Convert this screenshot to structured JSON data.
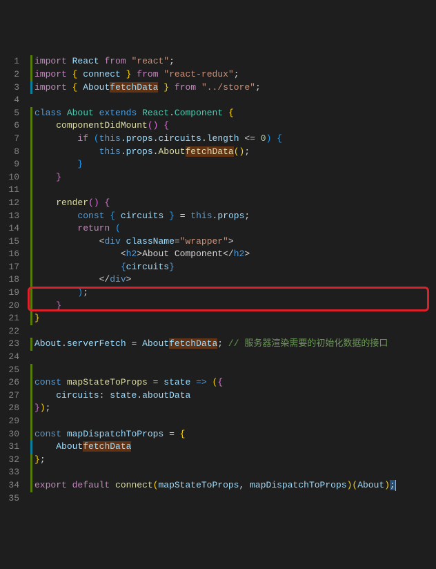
{
  "gutter": {
    "start": 1,
    "end": 35
  },
  "highlight_word": "fetchData",
  "code": {
    "l1": {
      "tokens": [
        [
          "kw2",
          "import"
        ],
        [
          "op",
          " "
        ],
        [
          "var",
          "React"
        ],
        [
          "op",
          " "
        ],
        [
          "kw2",
          "from"
        ],
        [
          "op",
          " "
        ],
        [
          "str",
          "\"react\""
        ],
        [
          "pun",
          ";"
        ]
      ],
      "mod": "green"
    },
    "l2": {
      "tokens": [
        [
          "kw2",
          "import"
        ],
        [
          "op",
          " "
        ],
        [
          "brk",
          "{"
        ],
        [
          "op",
          " "
        ],
        [
          "var",
          "connect"
        ],
        [
          "op",
          " "
        ],
        [
          "brk",
          "}"
        ],
        [
          "op",
          " "
        ],
        [
          "kw2",
          "from"
        ],
        [
          "op",
          " "
        ],
        [
          "str",
          "\"react-redux\""
        ],
        [
          "pun",
          ";"
        ]
      ],
      "mod": "green"
    },
    "l3": {
      "tokens": [
        [
          "kw2",
          "import"
        ],
        [
          "op",
          " "
        ],
        [
          "brk",
          "{"
        ],
        [
          "op",
          " "
        ],
        [
          "var",
          "About"
        ],
        [
          "var hl",
          "fetchData"
        ],
        [
          "op",
          " "
        ],
        [
          "brk",
          "}"
        ],
        [
          "op",
          " "
        ],
        [
          "kw2",
          "from"
        ],
        [
          "op",
          " "
        ],
        [
          "str",
          "\"../store\""
        ],
        [
          "pun",
          ";"
        ]
      ],
      "mod": "blue"
    },
    "l4": {
      "tokens": [],
      "mod": null
    },
    "l5": {
      "tokens": [
        [
          "kw",
          "class"
        ],
        [
          "op",
          " "
        ],
        [
          "cls",
          "About"
        ],
        [
          "op",
          " "
        ],
        [
          "kw",
          "extends"
        ],
        [
          "op",
          " "
        ],
        [
          "cls",
          "React"
        ],
        [
          "pun",
          "."
        ],
        [
          "cls",
          "Component"
        ],
        [
          "op",
          " "
        ],
        [
          "brk",
          "{"
        ]
      ],
      "mod": "green"
    },
    "l6": {
      "tokens": [
        [
          "op",
          "    "
        ],
        [
          "fn",
          "componentDidMount"
        ],
        [
          "brk2",
          "()"
        ],
        [
          "op",
          " "
        ],
        [
          "brk2",
          "{"
        ]
      ],
      "mod": "green"
    },
    "l7": {
      "tokens": [
        [
          "op",
          "        "
        ],
        [
          "kw2",
          "if"
        ],
        [
          "op",
          " "
        ],
        [
          "brk3",
          "("
        ],
        [
          "kw",
          "this"
        ],
        [
          "pun",
          "."
        ],
        [
          "var",
          "props"
        ],
        [
          "pun",
          "."
        ],
        [
          "var",
          "circuits"
        ],
        [
          "pun",
          "."
        ],
        [
          "var",
          "length"
        ],
        [
          "op",
          " <= "
        ],
        [
          "num",
          "0"
        ],
        [
          "brk3",
          ")"
        ],
        [
          "op",
          " "
        ],
        [
          "brk3",
          "{"
        ]
      ],
      "mod": "green"
    },
    "l8": {
      "tokens": [
        [
          "op",
          "            "
        ],
        [
          "kw",
          "this"
        ],
        [
          "pun",
          "."
        ],
        [
          "var",
          "props"
        ],
        [
          "pun",
          "."
        ],
        [
          "fn",
          "About"
        ],
        [
          "fn hl",
          "fetchData"
        ],
        [
          "brk",
          "()"
        ],
        [
          "pun",
          ";"
        ]
      ],
      "mod": "green"
    },
    "l9": {
      "tokens": [
        [
          "op",
          "        "
        ],
        [
          "brk3",
          "}"
        ]
      ],
      "mod": "green"
    },
    "l10": {
      "tokens": [
        [
          "op",
          "    "
        ],
        [
          "brk2",
          "}"
        ]
      ],
      "mod": "green"
    },
    "l11": {
      "tokens": [],
      "mod": "green"
    },
    "l12": {
      "tokens": [
        [
          "op",
          "    "
        ],
        [
          "fn",
          "render"
        ],
        [
          "brk2",
          "()"
        ],
        [
          "op",
          " "
        ],
        [
          "brk2",
          "{"
        ]
      ],
      "mod": "green"
    },
    "l13": {
      "tokens": [
        [
          "op",
          "        "
        ],
        [
          "kw",
          "const"
        ],
        [
          "op",
          " "
        ],
        [
          "brk3",
          "{"
        ],
        [
          "op",
          " "
        ],
        [
          "var",
          "circuits"
        ],
        [
          "op",
          " "
        ],
        [
          "brk3",
          "}"
        ],
        [
          "op",
          " = "
        ],
        [
          "kw",
          "this"
        ],
        [
          "pun",
          "."
        ],
        [
          "var",
          "props"
        ],
        [
          "pun",
          ";"
        ]
      ],
      "mod": "green"
    },
    "l14": {
      "tokens": [
        [
          "op",
          "        "
        ],
        [
          "kw2",
          "return"
        ],
        [
          "op",
          " "
        ],
        [
          "brk3",
          "("
        ]
      ],
      "mod": "green"
    },
    "l15": {
      "tokens": [
        [
          "op",
          "            "
        ],
        [
          "pun",
          "<"
        ],
        [
          "tag",
          "div"
        ],
        [
          "op",
          " "
        ],
        [
          "attr",
          "className"
        ],
        [
          "pun",
          "="
        ],
        [
          "str",
          "\"wrapper\""
        ],
        [
          "pun",
          ">"
        ]
      ],
      "mod": "green"
    },
    "l16": {
      "tokens": [
        [
          "op",
          "                "
        ],
        [
          "pun",
          "<"
        ],
        [
          "tag",
          "h2"
        ],
        [
          "pun",
          ">"
        ],
        [
          "op",
          "About Component"
        ],
        [
          "pun",
          "</"
        ],
        [
          "tag",
          "h2"
        ],
        [
          "pun",
          ">"
        ]
      ],
      "mod": "green"
    },
    "l17": {
      "tokens": [
        [
          "op",
          "                "
        ],
        [
          "kw",
          "{"
        ],
        [
          "var",
          "circuits"
        ],
        [
          "kw",
          "}"
        ]
      ],
      "mod": "green"
    },
    "l18": {
      "tokens": [
        [
          "op",
          "            "
        ],
        [
          "pun",
          "</"
        ],
        [
          "tag",
          "div"
        ],
        [
          "pun",
          ">"
        ]
      ],
      "mod": "green"
    },
    "l19": {
      "tokens": [
        [
          "op",
          "        "
        ],
        [
          "brk3",
          ")"
        ],
        [
          "pun",
          ";"
        ]
      ],
      "mod": "green"
    },
    "l20": {
      "tokens": [
        [
          "op",
          "    "
        ],
        [
          "brk2",
          "}"
        ]
      ],
      "mod": "green"
    },
    "l21": {
      "tokens": [
        [
          "brk",
          "}"
        ]
      ],
      "mod": "green"
    },
    "l22": {
      "tokens": [],
      "mod": null
    },
    "l23": {
      "tokens": [
        [
          "var",
          "About"
        ],
        [
          "pun",
          "."
        ],
        [
          "var",
          "serverFetch"
        ],
        [
          "op",
          " = "
        ],
        [
          "var",
          "About"
        ],
        [
          "var hl",
          "fetchData"
        ],
        [
          "pun",
          ";"
        ],
        [
          "op",
          " "
        ],
        [
          "cmt",
          "// 服务器渲染需要的初始化数据的接口"
        ]
      ],
      "mod": "green",
      "highlight_row": true
    },
    "l24": {
      "tokens": [],
      "mod": null
    },
    "l25": {
      "tokens": [],
      "mod": "green"
    },
    "l26": {
      "tokens": [
        [
          "kw",
          "const"
        ],
        [
          "op",
          " "
        ],
        [
          "fn",
          "mapStateToProps"
        ],
        [
          "op",
          " = "
        ],
        [
          "var",
          "state"
        ],
        [
          "op",
          " "
        ],
        [
          "kw",
          "=>"
        ],
        [
          "op",
          " "
        ],
        [
          "brk",
          "("
        ],
        [
          "brk2",
          "{"
        ]
      ],
      "mod": "green"
    },
    "l27": {
      "tokens": [
        [
          "op",
          "    "
        ],
        [
          "var",
          "circuits"
        ],
        [
          "pun",
          ":"
        ],
        [
          "op",
          " "
        ],
        [
          "var",
          "state"
        ],
        [
          "pun",
          "."
        ],
        [
          "var",
          "aboutData"
        ]
      ],
      "mod": "green"
    },
    "l28": {
      "tokens": [
        [
          "brk2",
          "}"
        ],
        [
          "brk",
          ")"
        ],
        [
          "pun",
          ";"
        ]
      ],
      "mod": "green"
    },
    "l29": {
      "tokens": [],
      "mod": "green"
    },
    "l30": {
      "tokens": [
        [
          "kw",
          "const"
        ],
        [
          "op",
          " "
        ],
        [
          "var",
          "mapDispatchToProps"
        ],
        [
          "op",
          " = "
        ],
        [
          "brk",
          "{"
        ]
      ],
      "mod": "green"
    },
    "l31": {
      "tokens": [
        [
          "op",
          "    "
        ],
        [
          "var",
          "About"
        ],
        [
          "var hl",
          "fetchData"
        ]
      ],
      "mod": "blue"
    },
    "l32": {
      "tokens": [
        [
          "brk",
          "}"
        ],
        [
          "pun",
          ";"
        ]
      ],
      "mod": "green"
    },
    "l33": {
      "tokens": [],
      "mod": "green"
    },
    "l34": {
      "tokens": [
        [
          "kw2",
          "export"
        ],
        [
          "op",
          " "
        ],
        [
          "kw2",
          "default"
        ],
        [
          "op",
          " "
        ],
        [
          "fn",
          "connect"
        ],
        [
          "brk",
          "("
        ],
        [
          "var",
          "mapStateToProps"
        ],
        [
          "pun",
          ","
        ],
        [
          "op",
          " "
        ],
        [
          "var",
          "mapDispatchToProps"
        ],
        [
          "brk",
          ")"
        ],
        [
          "brk",
          "("
        ],
        [
          "var",
          "About"
        ],
        [
          "brk",
          ")"
        ],
        [
          "pun sel",
          ";"
        ]
      ],
      "mod": "green",
      "caret": true
    },
    "l35": {
      "tokens": [],
      "mod": null
    }
  }
}
